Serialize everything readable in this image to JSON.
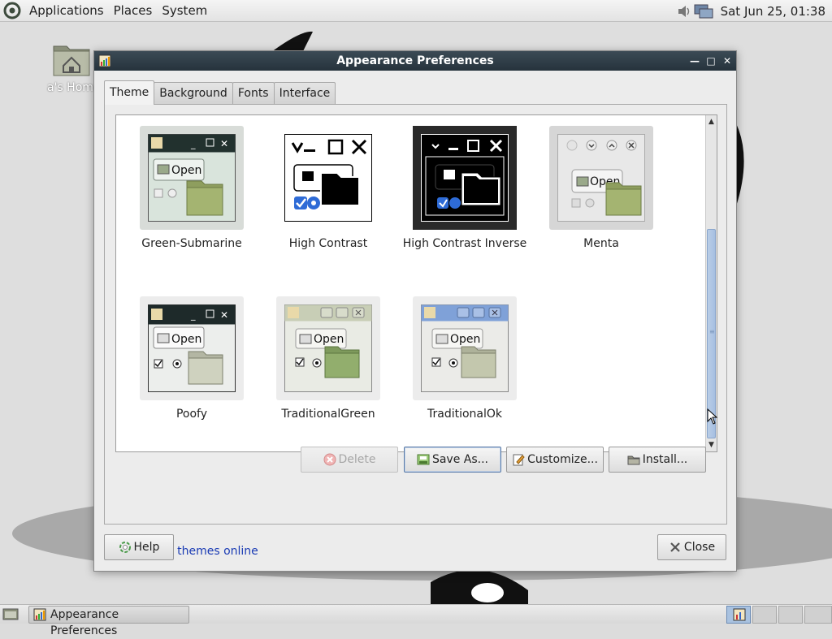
{
  "top_panel": {
    "menus": [
      "Applications",
      "Places",
      "System"
    ],
    "clock": "Sat Jun 25, 01:38"
  },
  "desktop": {
    "home_icon_label": "a's Home"
  },
  "window": {
    "title": "Appearance Preferences",
    "tabs": [
      {
        "label": "Theme",
        "active": true
      },
      {
        "label": "Background",
        "active": false
      },
      {
        "label": "Fonts",
        "active": false
      },
      {
        "label": "Interface",
        "active": false
      }
    ],
    "themes": [
      {
        "name": "Green-Submarine",
        "selected": true
      },
      {
        "name": "High Contrast",
        "selected": false
      },
      {
        "name": "High Contrast Inverse",
        "selected": false
      },
      {
        "name": "Menta",
        "selected": false
      },
      {
        "name": "Poofy",
        "selected": false
      },
      {
        "name": "TraditionalGreen",
        "selected": false
      },
      {
        "name": "TraditionalOk",
        "selected": false
      }
    ],
    "preview_open_label": "Open",
    "buttons": {
      "delete": "Delete",
      "save_as": "Save As...",
      "customize": "Customize...",
      "install": "Install..."
    },
    "more_link": "Get more themes online",
    "help": "Help",
    "close": "Close"
  },
  "taskbar": {
    "task": "Appearance Preferences"
  },
  "colors": {
    "titlebar": "#2f3c46",
    "link": "#1a3bb4",
    "scroll_thumb": "#a6bfe2"
  }
}
